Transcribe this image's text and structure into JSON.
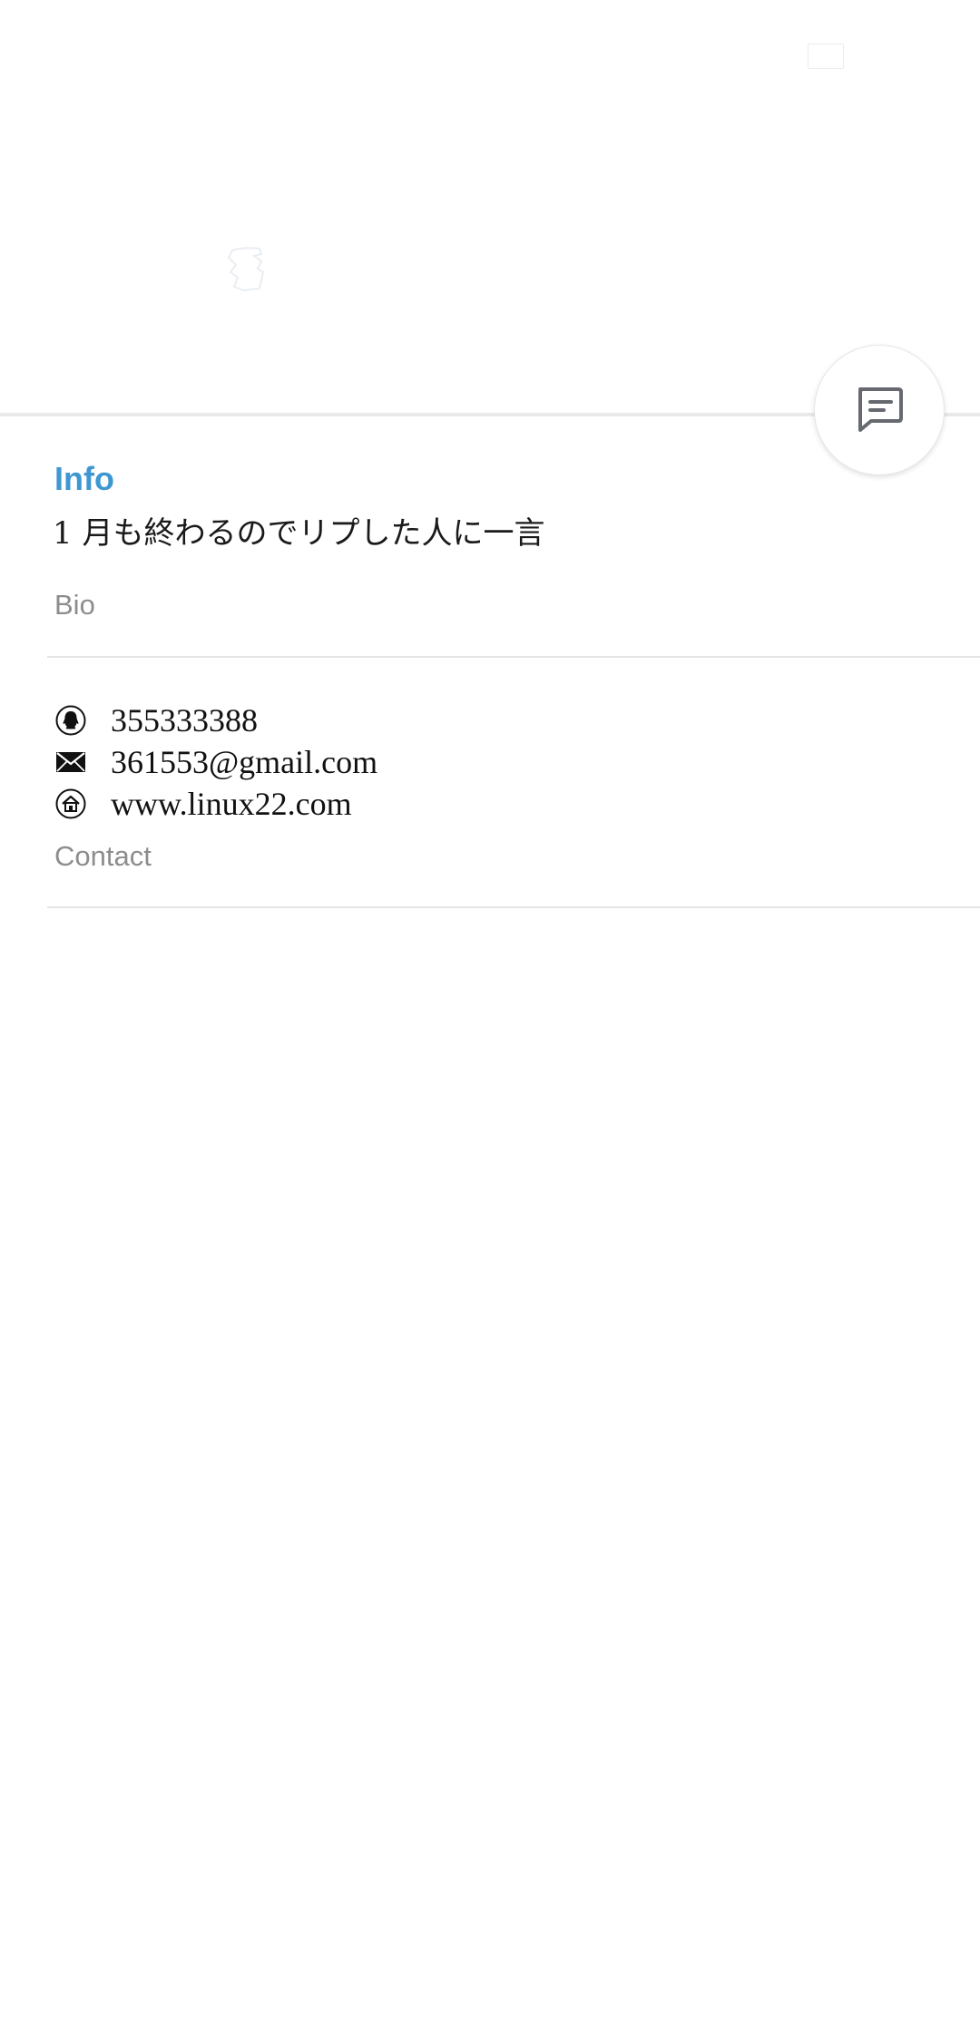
{
  "profile": {
    "section_title": "Info",
    "bio": {
      "text": "1 月も終わるのでリプした人に一言",
      "caption": "Bio"
    },
    "contact": {
      "caption": "Contact",
      "items": [
        {
          "icon": "qq-icon",
          "value": "355333388"
        },
        {
          "icon": "mail-icon",
          "value": "361553@gmail.com"
        },
        {
          "icon": "home-icon",
          "value": "www.linux22.com"
        }
      ]
    }
  },
  "fab": {
    "icon": "message-icon"
  },
  "colors": {
    "accent": "#3f97d2",
    "caption": "#8d8d8d",
    "divider": "#e5e5e5"
  }
}
